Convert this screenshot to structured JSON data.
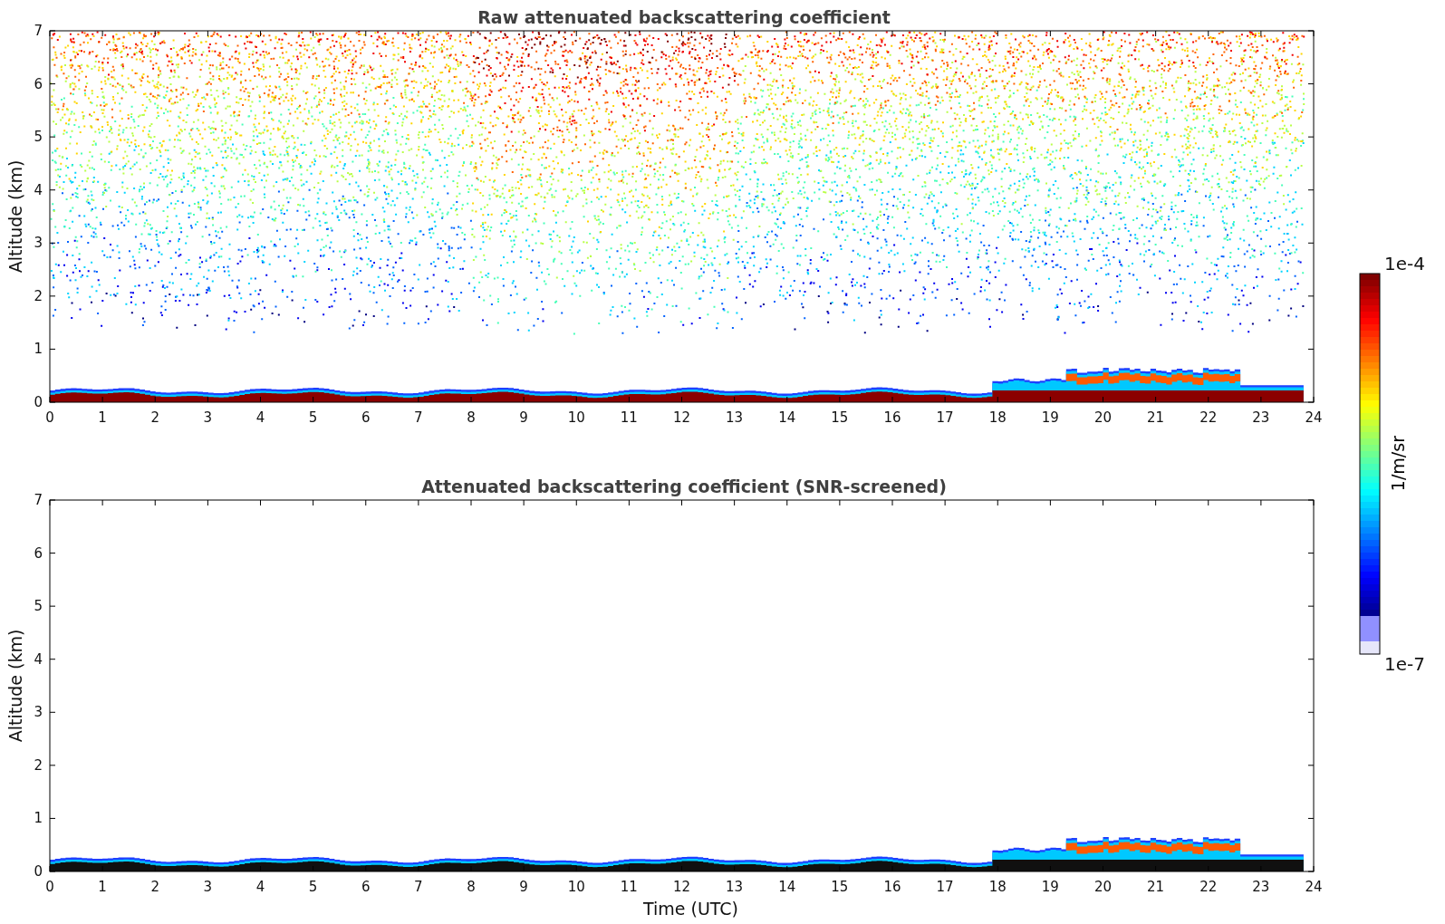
{
  "panels": [
    {
      "kind": "raw",
      "title": "Raw attenuated backscattering coefficient",
      "ylabel": "Altitude (km)",
      "yticks": [
        "7",
        "6",
        "5",
        "4",
        "3",
        "2",
        "1",
        "0"
      ],
      "xticks": [
        "0",
        "1",
        "2",
        "3",
        "4",
        "5",
        "6",
        "7",
        "8",
        "9",
        "10",
        "11",
        "12",
        "13",
        "14",
        "15",
        "16",
        "17",
        "18",
        "19",
        "20",
        "21",
        "22",
        "23",
        "24"
      ]
    },
    {
      "kind": "screened",
      "title": "Attenuated backscattering coefficient (SNR-screened)",
      "ylabel": "Altitude (km)",
      "yticks": [
        "7",
        "6",
        "5",
        "4",
        "3",
        "2",
        "1",
        "0"
      ],
      "xticks": [
        "0",
        "1",
        "2",
        "3",
        "4",
        "5",
        "6",
        "7",
        "8",
        "9",
        "10",
        "11",
        "12",
        "13",
        "14",
        "15",
        "16",
        "17",
        "18",
        "19",
        "20",
        "21",
        "22",
        "23",
        "24"
      ],
      "xlabel": "Time (UTC)"
    }
  ],
  "colorbar": {
    "max_label": "1e-4",
    "min_label": "1e-7",
    "unit": "1/m/sr"
  }
}
